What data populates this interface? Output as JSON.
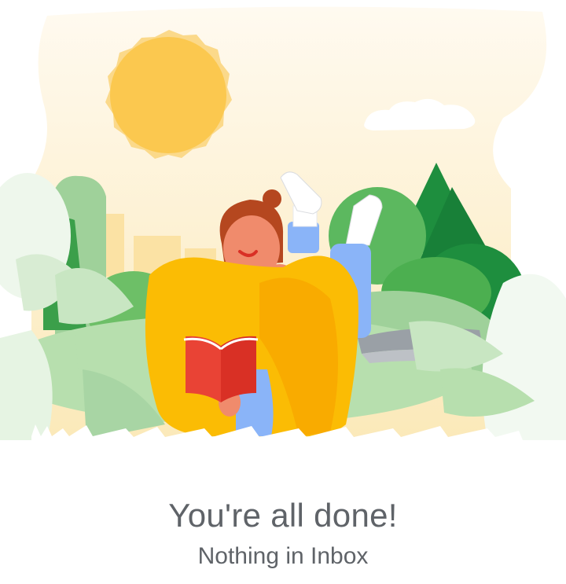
{
  "empty_state": {
    "title": "You're all done!",
    "subtitle": "Nothing in Inbox",
    "illustration_icon": "person-reading-book-in-park-illustration"
  },
  "colors": {
    "sky": "#fdf3d4",
    "sun": "#fbc84f",
    "sun_rays": "#fbd98a",
    "dark_green": "#1e8e3e",
    "mid_green": "#5cb85f",
    "light_green": "#a8d5a4",
    "sweater": "#fbbc04",
    "book": "#e94335",
    "jeans": "#8ab4f8",
    "hair": "#b5471f",
    "skin": "#f08b6c",
    "text": "#5f6368"
  }
}
